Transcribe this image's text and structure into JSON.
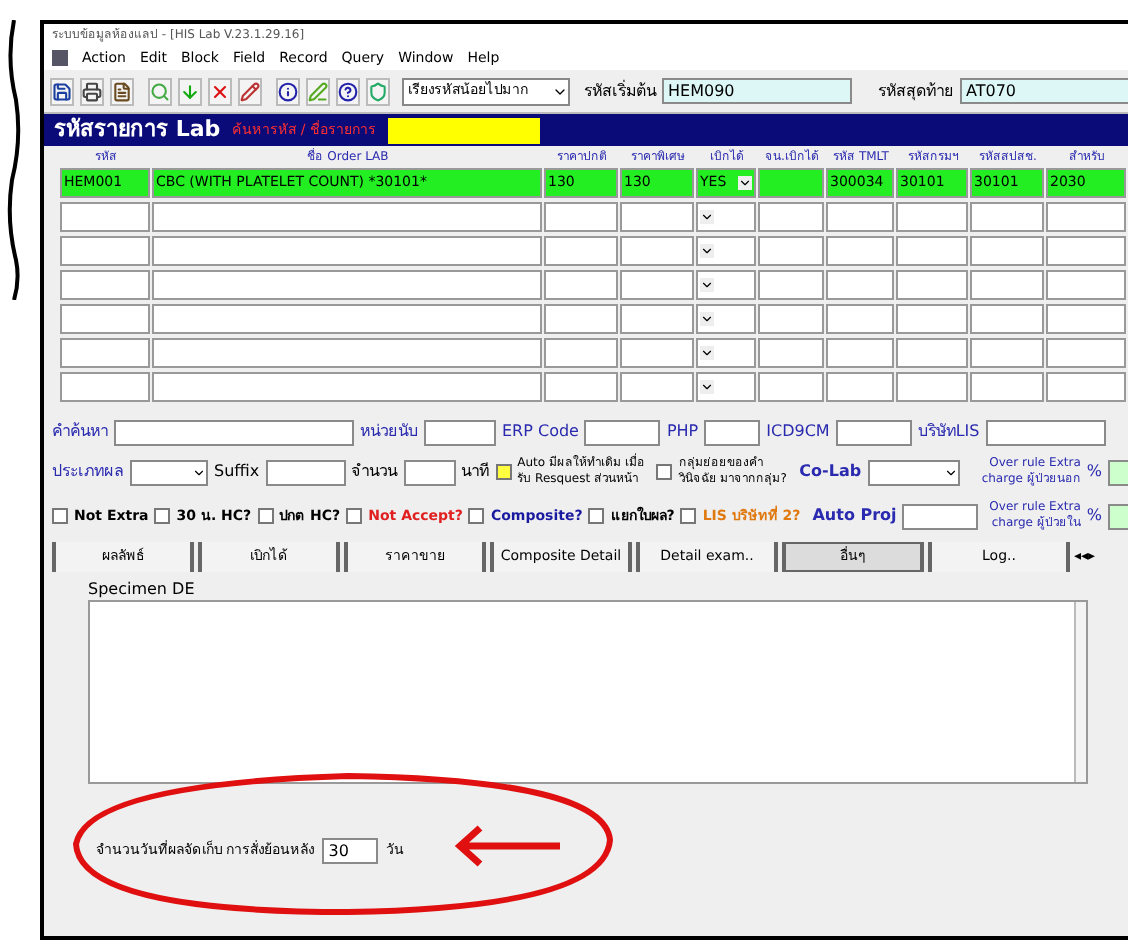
{
  "window": {
    "title": "ระบบข้อมูลห้องแลป - [HIS Lab V.23.1.29.16]"
  },
  "menu": [
    "Action",
    "Edit",
    "Block",
    "Field",
    "Record",
    "Query",
    "Window",
    "Help"
  ],
  "toolbar": {
    "sort_select": "เรียงรหัสน้อยไปมาก",
    "start_label": "รหัสเริ่มต้น",
    "start_value": "HEM090",
    "end_label": "รหัสสุดท้าย",
    "end_value": "AT070"
  },
  "header": {
    "title": "รหัสรายการ Lab",
    "search_label": "ค้นหารหัส / ชื่อรายการ"
  },
  "table": {
    "columns": [
      {
        "label": "รหัส",
        "kind": "text"
      },
      {
        "label": "ชื่อ Order LAB",
        "kind": "text"
      },
      {
        "label": "ราคาปกติ",
        "kind": "text"
      },
      {
        "label": "ราคาพิเศษ",
        "kind": "text"
      },
      {
        "label": "เบิกได้",
        "kind": "select"
      },
      {
        "label": "จน.เบิกได้",
        "kind": "text"
      },
      {
        "label": "รหัส TMLT",
        "kind": "text"
      },
      {
        "label": "รหัสกรมฯ",
        "kind": "text"
      },
      {
        "label": "รหัสสปสช.",
        "kind": "text"
      },
      {
        "label": "สำหรับ",
        "kind": "text"
      }
    ],
    "rows": [
      {
        "selected": true,
        "cells": [
          "HEM001",
          "CBC (WITH PLATELET COUNT) *30101*",
          "130",
          "130",
          "YES",
          "",
          "300034",
          "30101",
          "30101",
          "2030"
        ]
      }
    ]
  },
  "fields_row1": [
    {
      "label": "คำค้นหา"
    },
    {
      "label": "หน่วยนับ"
    },
    {
      "label": "ERP Code"
    },
    {
      "label": "PHP"
    },
    {
      "label": "ICD9CM"
    },
    {
      "label": "บริษัทLIS"
    }
  ],
  "fields_row2": {
    "type_label": "ประเภทผล",
    "suffix_label": "Suffix",
    "count_label": "จำนวน",
    "minute_label": "นาที",
    "auto_label": "Auto มีผลให้ทำเดิม เมื่อรับ Resquest ส่วนหน้า",
    "auto_checked": false,
    "group_label": "กลุ่มย่อยของคำวินิจฉัย มาจากกลุ่ม?",
    "group_checked": false,
    "colab_label": "Co-Lab",
    "over_label": "Over rule Extra charge ผู้ป่วยนอก"
  },
  "checks": [
    {
      "label": "Not Extra",
      "checked": false,
      "color": "#000000"
    },
    {
      "label": "30 น. HC?",
      "checked": false,
      "color": "#000000"
    },
    {
      "label": "ปกต HC?",
      "checked": false,
      "color": "#000000"
    },
    {
      "label": "Not Accept?",
      "checked": false,
      "color": "#e02020"
    },
    {
      "label": "Composite?",
      "checked": false,
      "color": "#1a1aa0"
    },
    {
      "label": "แยกใบผล?",
      "checked": false,
      "color": "#000000"
    },
    {
      "label": "LIS บริษัทที่ 2?",
      "checked": false,
      "color": "#e07a10"
    }
  ],
  "auto_proj_label": "Auto Proj",
  "over_in_label": "Over rule Extra charge ผู้ป่วยใน",
  "percent": "%",
  "tabs": [
    {
      "label": "ผลลัพธ์",
      "selected": false
    },
    {
      "label": "เบิกได้",
      "selected": false
    },
    {
      "label": "ราคาขาย",
      "selected": false
    },
    {
      "label": "Composite Detail",
      "selected": false
    },
    {
      "label": "Detail exam..",
      "selected": false
    },
    {
      "label": "อื่นๆ",
      "selected": true
    },
    {
      "label": "Log..",
      "selected": false
    }
  ],
  "tab_scroll": "◂◂▸",
  "specimen_label": "Specimen DE",
  "retention": {
    "label": "จำนวนวันที่ผลจัดเก็บ การสั่งย้อนหลัง",
    "value": "30",
    "unit": "วัน"
  }
}
